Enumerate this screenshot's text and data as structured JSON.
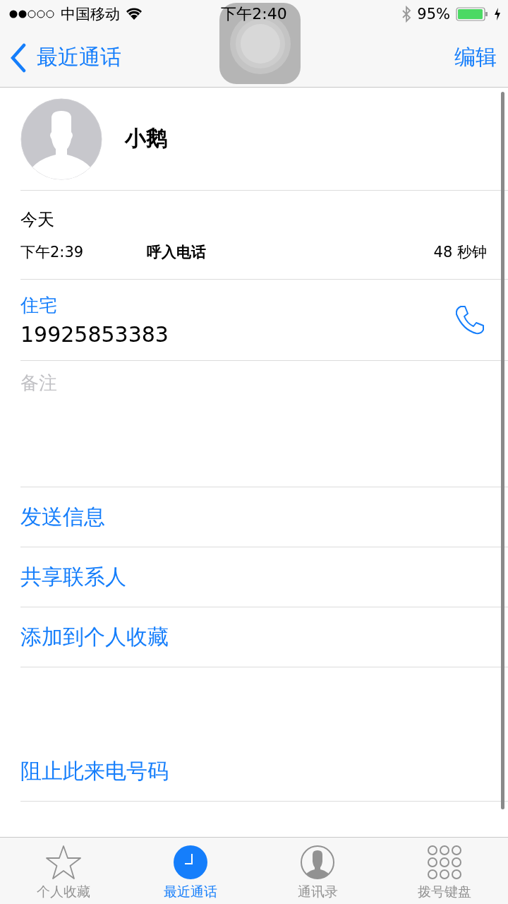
{
  "status_bar": {
    "carrier": "中国移动",
    "time": "下午2:40",
    "battery": "95%",
    "charging": true
  },
  "nav": {
    "back": "最近通话",
    "action": "编辑"
  },
  "contact": {
    "name": "小鹅"
  },
  "call_history": {
    "date": "今天",
    "calls": [
      {
        "time": "下午2:39",
        "type": "呼入电话",
        "duration": "48 秒钟"
      }
    ]
  },
  "phone": {
    "label": "住宅",
    "number": "19925853383"
  },
  "notes": {
    "placeholder": "备注"
  },
  "actions": [
    "发送信息",
    "共享联系人",
    "添加到个人收藏"
  ],
  "block_action": "阻止此来电号码",
  "tabs": [
    {
      "label": "个人收藏",
      "kind": "star",
      "selected": false
    },
    {
      "label": "最近通话",
      "kind": "clock",
      "selected": true
    },
    {
      "label": "通讯录",
      "kind": "person",
      "selected": false
    },
    {
      "label": "拨号键盘",
      "kind": "keypad",
      "selected": false
    }
  ]
}
